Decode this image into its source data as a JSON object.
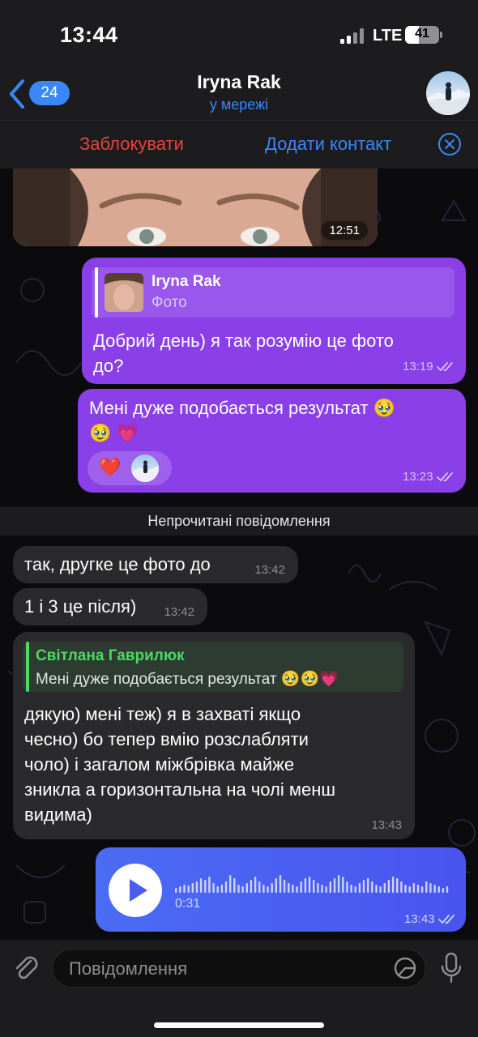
{
  "status_bar": {
    "time": "13:44",
    "network": "LTE",
    "battery": "41",
    "battery_level": 0.41
  },
  "header": {
    "back_count": "24",
    "title": "Iryna Rak",
    "subtitle": "у мережі"
  },
  "action_bar": {
    "block_label": "Заблокувати",
    "add_contact_label": "Додати контакт"
  },
  "messages": {
    "photo": {
      "time": "12:51"
    },
    "out_reply": {
      "reply_name": "Iryna Rak",
      "reply_type": "Фото",
      "text_line1": "Добрий день) я так розумію це  фото",
      "text_line2": "до?",
      "time": "13:19"
    },
    "out_result": {
      "text_line1": "Мені дуже подобається результат 🥹",
      "text_line2": "🥹 💗",
      "reaction": "❤️",
      "time": "13:23"
    },
    "unread_label": "Непрочитані повідомлення",
    "in_1": {
      "text": "так, другке це фото до",
      "time": "13:42"
    },
    "in_2": {
      "text": "1 і 3 це після)",
      "time": "13:42"
    },
    "in_reply": {
      "reply_name": "Світлана Гаврилюк",
      "reply_text": "Мені дуже подобається результат 🥹🥹💗",
      "line1": "дякую) мені теж) я в захваті якщо",
      "line2": "чесно) бо тепер вмію розслабляти",
      "line3": "чоло) і загалом міжбрівка майже",
      "line4": "зникла а горизонтальна на чолі менш",
      "line5": "видима)",
      "time": "13:43"
    },
    "voice": {
      "duration": "0:31",
      "time": "13:43"
    }
  },
  "input": {
    "placeholder": "Повідомлення"
  },
  "colors": {
    "accent": "#3a88f7",
    "outgoing_bubble": "#8a3fe8",
    "voice_bubble": "#4a5cf2",
    "block": "#e7453a",
    "reply_green": "#4cd964"
  },
  "icons": [
    "back-chevron-icon",
    "close-circle-icon",
    "paperclip-icon",
    "sticker-icon",
    "microphone-icon",
    "play-icon",
    "double-check-icon",
    "heart-icon",
    "signal-icon",
    "battery-icon"
  ]
}
